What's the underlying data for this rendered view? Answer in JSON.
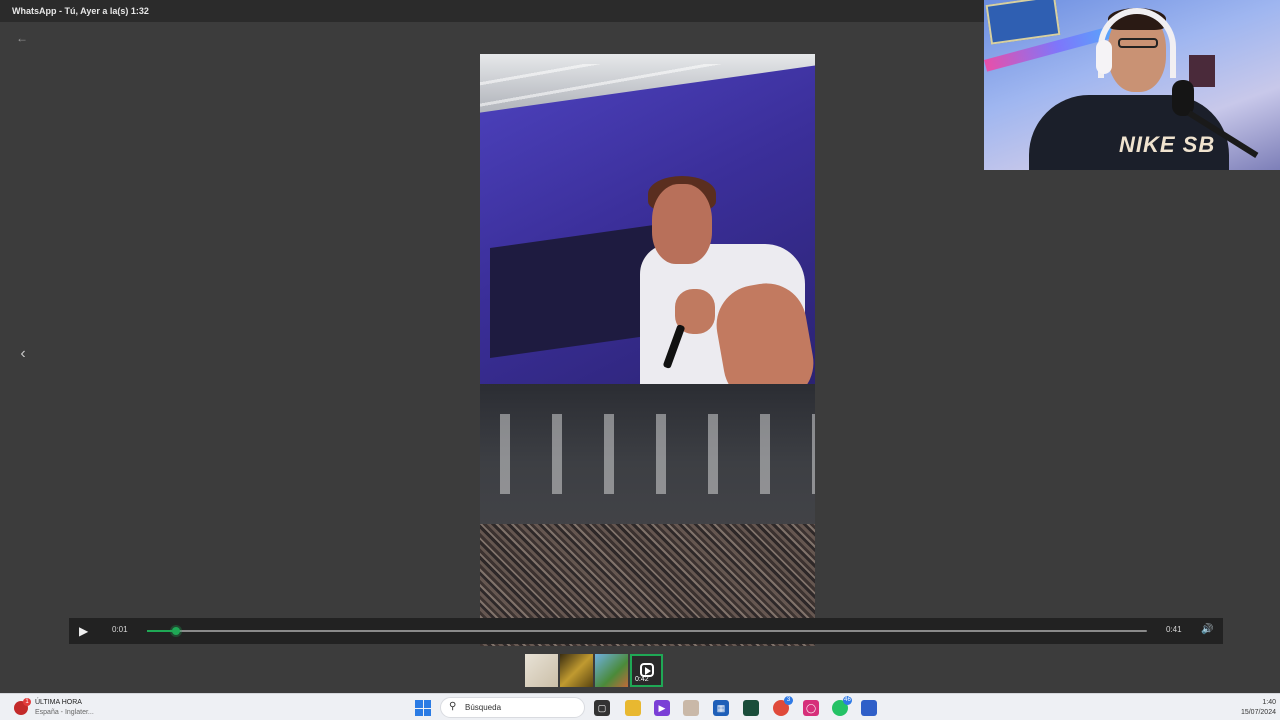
{
  "window": {
    "title": "WhatsApp - Tú, Ayer a la(s) 1:32"
  },
  "player": {
    "current_time": "0:01",
    "total_time": "0:41",
    "progress": 0.029,
    "accent_color": "#1fa855"
  },
  "icons": {
    "back": "arrow-left-icon",
    "prev": "chevron-left-icon",
    "play": "play-icon",
    "volume": "volume-icon"
  },
  "thumbnails": [
    {
      "kind": "image"
    },
    {
      "kind": "image"
    },
    {
      "kind": "image"
    },
    {
      "kind": "video",
      "duration": "0:42",
      "selected": true
    }
  ],
  "webcam": {
    "shirt_text": "NIKE SB"
  },
  "taskbar": {
    "news_title": "ÚLTIMA HORA",
    "news_sub": "España - Inglater...",
    "news_badge": "1",
    "search_placeholder": "Búsqueda",
    "apps": [
      {
        "name": "file-explorer",
        "badge": ""
      },
      {
        "name": "folder",
        "badge": ""
      },
      {
        "name": "media-player",
        "badge": ""
      },
      {
        "name": "paint",
        "badge": ""
      },
      {
        "name": "store",
        "badge": ""
      },
      {
        "name": "terminal",
        "badge": ""
      },
      {
        "name": "chrome",
        "badge": "3"
      },
      {
        "name": "instagram",
        "badge": ""
      },
      {
        "name": "whatsapp",
        "badge": "46"
      },
      {
        "name": "app-blue",
        "badge": ""
      }
    ],
    "clock_time": "1:40",
    "clock_date": "15/07/2024"
  }
}
